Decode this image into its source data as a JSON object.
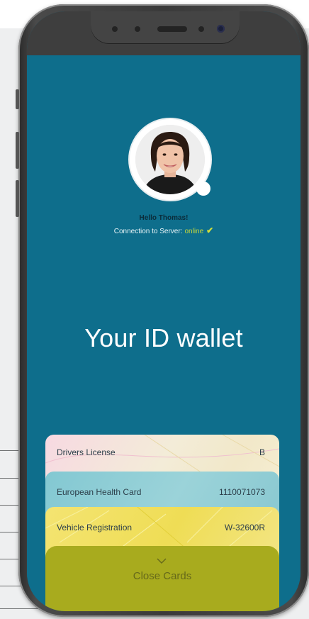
{
  "profile": {
    "greeting": "Hello Thomas!",
    "connection_label": "Connection to Server:",
    "connection_status": "online"
  },
  "wallet": {
    "title": "Your ID wallet"
  },
  "cards": [
    {
      "name": "Drivers License",
      "value": "B"
    },
    {
      "name": "European Health Card",
      "value": "1110071073"
    },
    {
      "name": "Vehicle Registration",
      "value": "W-32600R"
    }
  ],
  "actions": {
    "close_cards": "Close Cards"
  },
  "icons": {
    "checkmark": "check-icon",
    "chevron": "chevron-down-icon"
  },
  "colors": {
    "screen_bg": "#0e6e8c",
    "online": "#c4d63d",
    "close_bar": "#a8ab1e"
  }
}
